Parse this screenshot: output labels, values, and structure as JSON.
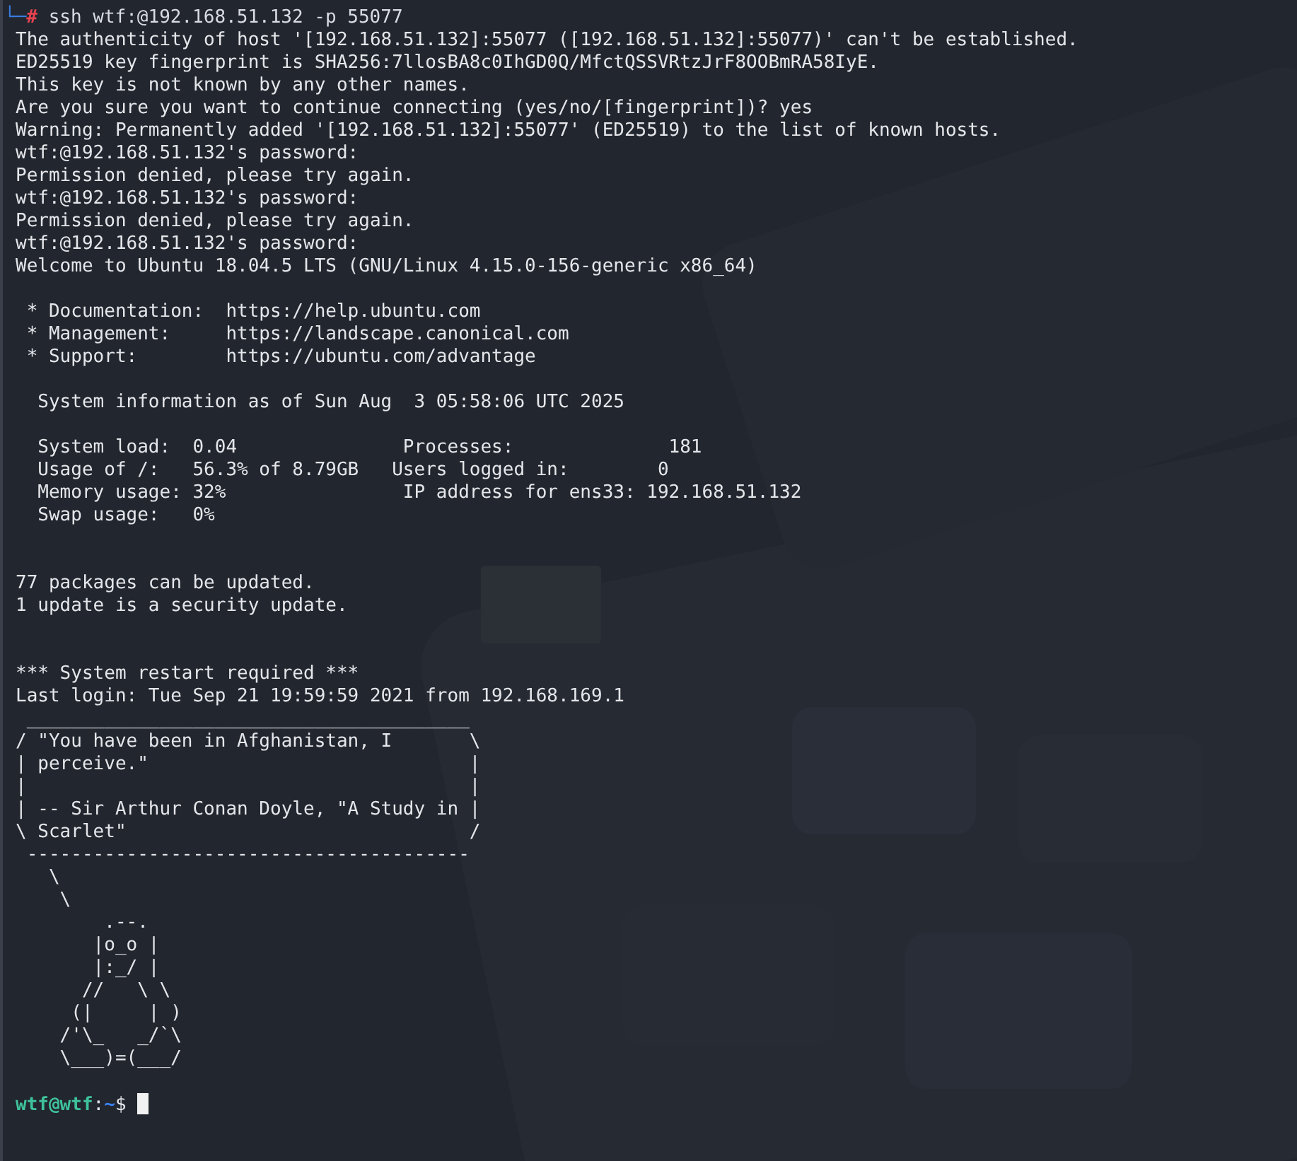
{
  "terminal": {
    "command": {
      "corner": "└─",
      "prompt": "#",
      "text": "ssh wtf:@192.168.51.132 -p 55077"
    },
    "blocks": [
      {
        "kind": "session",
        "lines": [
          "The authenticity of host '[192.168.51.132]:55077 ([192.168.51.132]:55077)' can't be established.",
          "ED25519 key fingerprint is SHA256:7llosBA8c0IhGD0Q/MfctQSSVRtzJrF8OOBmRA58IyE.",
          "This key is not known by any other names.",
          "Are you sure you want to continue connecting (yes/no/[fingerprint])? yes",
          "Warning: Permanently added '[192.168.51.132]:55077' (ED25519) to the list of known hosts.",
          "wtf:@192.168.51.132's password:",
          "Permission denied, please try again.",
          "wtf:@192.168.51.132's password:",
          "Permission denied, please try again.",
          "wtf:@192.168.51.132's password:",
          "Welcome to Ubuntu 18.04.5 LTS (GNU/Linux 4.15.0-156-generic x86_64)"
        ]
      },
      {
        "kind": "links",
        "lines": [
          " * Documentation:  https://help.ubuntu.com",
          " * Management:     https://landscape.canonical.com",
          " * Support:        https://ubuntu.com/advantage"
        ]
      },
      {
        "kind": "header",
        "lines": [
          "  System information as of Sun Aug  3 05:58:06 UTC 2025"
        ]
      },
      {
        "kind": "stats",
        "lines": [
          "  System load:  0.04               Processes:              181",
          "  Usage of /:   56.3% of 8.79GB   Users logged in:        0",
          "  Memory usage: 32%                IP address for ens33: 192.168.51.132",
          "  Swap usage:   0%"
        ]
      },
      {
        "kind": "updates",
        "lines": [
          "77 packages can be updated.",
          "1 update is a security update."
        ]
      },
      {
        "kind": "login",
        "lines": [
          "*** System restart required ***",
          "Last login: Tue Sep 21 19:59:59 2021 from 192.168.169.1"
        ]
      },
      {
        "kind": "cowsay",
        "lines": [
          " ________________________________________",
          "/ \"You have been in Afghanistan, I       \\",
          "| perceive.\"                             |",
          "|                                        |",
          "| -- Sir Arthur Conan Doyle, \"A Study in |",
          "\\ Scarlet\"                               /",
          " ----------------------------------------",
          "   \\",
          "    \\",
          "        .--.",
          "       |o_o |",
          "       |:_/ |",
          "      //   \\ \\",
          "     (|     | )",
          "    /'\\_   _/`\\",
          "    \\___)=(___/"
        ]
      }
    ],
    "prompt": {
      "user_host": "wtf@wtf",
      "separator": ":",
      "path": "~",
      "symbol": "$"
    }
  }
}
